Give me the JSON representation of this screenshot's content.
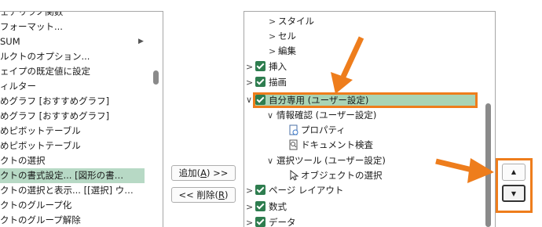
{
  "left_list": {
    "items": [
      {
        "label": "ェアリラノ関数"
      },
      {
        "label": "フォーマット..."
      },
      {
        "label": "SUM"
      },
      {
        "label": "ルクトのオプション..."
      },
      {
        "label": "ェイプの既定値に設定"
      },
      {
        "label": "ィルター"
      },
      {
        "label": "めグラフ [おすすめグラフ]"
      },
      {
        "label": "めグラフ [おすすめグラフ]"
      },
      {
        "label": "めピボットテーブル"
      },
      {
        "label": "めピボットテーブル"
      },
      {
        "label": "クトの選択"
      },
      {
        "label": "クトの書式設定... [図形の書…"
      },
      {
        "label": "クトの選択と表示... [[選択] ウ…"
      },
      {
        "label": "クトのグループ化"
      },
      {
        "label": "クトのグループ解除"
      }
    ],
    "selected_index": 11,
    "submenu_arrow_index": 2
  },
  "buttons": {
    "add": {
      "label": "追加(",
      "key": "A",
      "suffix": ") >>"
    },
    "remove": {
      "label": "<< 削除(",
      "key": "R",
      "suffix": ")"
    }
  },
  "tree": {
    "rows": [
      {
        "label": "スタイル",
        "level": 2,
        "chevron": ">",
        "checkbox": false
      },
      {
        "label": "セル",
        "level": 2,
        "chevron": ">",
        "checkbox": false
      },
      {
        "label": "編集",
        "level": 2,
        "chevron": ">",
        "checkbox": false
      },
      {
        "label": "挿入",
        "level": 0,
        "chevron": ">",
        "checkbox": true
      },
      {
        "label": "描画",
        "level": 0,
        "chevron": ">",
        "checkbox": true
      },
      {
        "label": "自分専用 (ユーザー設定)",
        "level": 0,
        "chevron": "∨",
        "checkbox": true,
        "highlight": true
      },
      {
        "label": "情報確認 (ユーザー設定)",
        "level": 1,
        "chevron": "∨",
        "checkbox": false
      },
      {
        "label": "プロパティ",
        "level": 2,
        "icon": "properties-icon"
      },
      {
        "label": "ドキュメント検査",
        "level": 2,
        "icon": "document-inspect-icon"
      },
      {
        "label": "選択ツール (ユーザー設定)",
        "level": 1,
        "chevron": "∨",
        "checkbox": false
      },
      {
        "label": "オブジェクトの選択",
        "level": 2,
        "icon": "pointer-icon"
      },
      {
        "label": "ページ レイアウト",
        "level": 0,
        "chevron": ">",
        "checkbox": true
      },
      {
        "label": "数式",
        "level": 0,
        "chevron": ">",
        "checkbox": true
      },
      {
        "label": "データ",
        "level": 0,
        "chevron": ">",
        "checkbox": true
      }
    ]
  },
  "move_buttons": {
    "up": "▲",
    "down": "▼"
  },
  "colors": {
    "accent_orange": "#ee7d1c",
    "checkbox_green": "#2e7d4f",
    "selection_green": "#a9d4b5"
  }
}
